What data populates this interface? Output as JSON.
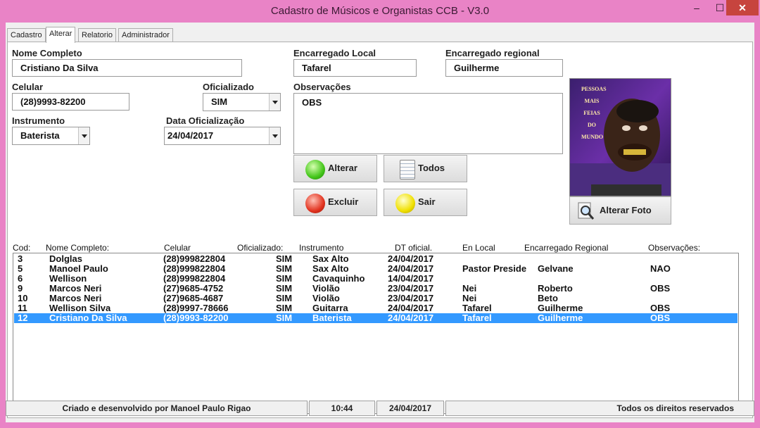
{
  "window": {
    "title": "Cadastro de Músicos e Organistas CCB - V3.0",
    "min_glyph": "–",
    "max_glyph": "☐",
    "close_glyph": "✕"
  },
  "tabs": [
    "Cadastro",
    "Alterar",
    "Relatorio",
    "Administrador"
  ],
  "form": {
    "nome_label": "Nome Completo",
    "nome_value": "Cristiano Da Silva",
    "celular_label": "Celular",
    "celular_value": "(28)9993-82200",
    "oficializado_label": "Oficializado",
    "oficializado_value": "SIM",
    "instrumento_label": "Instrumento",
    "instrumento_value": "Baterista",
    "data_label": "Data Oficialização",
    "data_value": "24/04/2017",
    "enc_local_label": "Encarregado Local",
    "enc_local_value": "Tafarel",
    "enc_regional_label": "Encarregado regional",
    "enc_regional_value": "Guilherme",
    "obs_label": "Observações",
    "obs_value": "OBS"
  },
  "buttons": {
    "alterar": "Alterar",
    "todos": "Todos",
    "excluir": "Excluir",
    "sair": "Sair",
    "alterar_foto": "Alterar Foto"
  },
  "photo": {
    "caption_words": [
      "PESSOAS",
      "MAIS",
      "FEIAS",
      "DO",
      "MUNDO"
    ]
  },
  "grid": {
    "headers": [
      "Cod:",
      "Nome Completo:",
      "Celular",
      "Oficializado:",
      "Instrumento",
      "DT oficial.",
      "En Local",
      "Encarregado Regional",
      "Observações:"
    ],
    "rows": [
      [
        "3",
        "Dolglas",
        "(28)999822804",
        "SIM",
        "Sax Alto",
        "24/04/2017",
        "",
        "",
        ""
      ],
      [
        "5",
        "Manoel Paulo",
        "(28)999822804",
        "SIM",
        "Sax Alto",
        "24/04/2017",
        "Pastor Preside",
        "Gelvane",
        "NAO"
      ],
      [
        "6",
        "Wellison",
        "(28)999822804",
        "SIM",
        "Cavaquinho",
        "14/04/2017",
        "",
        "",
        ""
      ],
      [
        "9",
        "Marcos Neri",
        "(27)9685-4752",
        "SIM",
        "Violão",
        "23/04/2017",
        "Nei",
        "Roberto",
        "OBS"
      ],
      [
        "10",
        "Marcos Neri",
        "(27)9685-4687",
        "SIM",
        "Violão",
        "23/04/2017",
        "Nei",
        "Beto",
        ""
      ],
      [
        "11",
        "Wellison Silva",
        "(28)9997-78666",
        "SIM",
        "Guitarra",
        "24/04/2017",
        "Tafarel",
        "Guilherme",
        "OBS"
      ],
      [
        "12",
        "Cristiano Da Silva",
        "(28)9993-82200",
        "SIM",
        "Baterista",
        "24/04/2017",
        "Tafarel",
        "Guilherme",
        "OBS"
      ]
    ],
    "selected_row": 6
  },
  "status": {
    "credits": "Criado e desenvolvido por Manoel Paulo Rigao",
    "time": "10:44",
    "date": "24/04/2017",
    "rights": "Todos os direitos reservados"
  },
  "colors": {
    "window_frame": "#e983c6",
    "selection": "#3399ff"
  }
}
